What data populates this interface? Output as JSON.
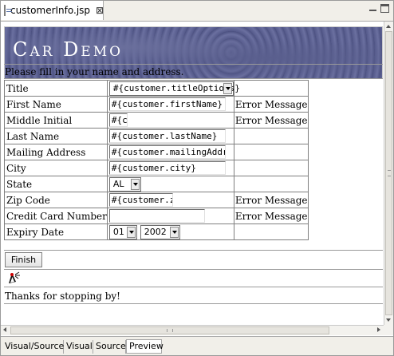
{
  "tab": {
    "title": "customerInfo.jsp",
    "close": "⊠"
  },
  "banner": {
    "title": "Car Demo"
  },
  "intro": "Please fill in your name and address.",
  "form_rows": [
    {
      "label": "Title",
      "value": "#{customer.titleOptions}",
      "error": ""
    },
    {
      "label": "First Name",
      "value": "#{customer.firstName}",
      "error": "Error Message"
    },
    {
      "label": "Middle Initial",
      "value": "#{c",
      "error": "Error Message"
    },
    {
      "label": "Last Name",
      "value": "#{customer.lastName}",
      "error": ""
    },
    {
      "label": "Mailing Address",
      "value": "#{customer.mailingAddres",
      "error": ""
    },
    {
      "label": "City",
      "value": "#{customer.city}",
      "error": ""
    },
    {
      "label": "State",
      "value": "AL",
      "error": ""
    },
    {
      "label": "Zip Code",
      "value": "#{customer.zip",
      "error": "Error Message"
    },
    {
      "label": "Credit Card Number",
      "value": "",
      "error": "Error Message"
    },
    {
      "label": "Expiry Date",
      "month": "01",
      "year": "2002",
      "error": ""
    }
  ],
  "finish_label": "Finish",
  "thanks": "Thanks for stopping by!",
  "mode_tabs": [
    {
      "label": "Visual/Source",
      "active": false
    },
    {
      "label": "Visual",
      "active": false
    },
    {
      "label": "Source",
      "active": false
    },
    {
      "label": "Preview",
      "active": true
    }
  ],
  "icons": {
    "file": "jsp-file-icon",
    "duke": "duke-mascot-icon",
    "minimize": "minimize-icon",
    "maximize": "maximize-icon"
  },
  "colors": {
    "banner": "#5a5f90",
    "chrome": "#f1efe9"
  }
}
